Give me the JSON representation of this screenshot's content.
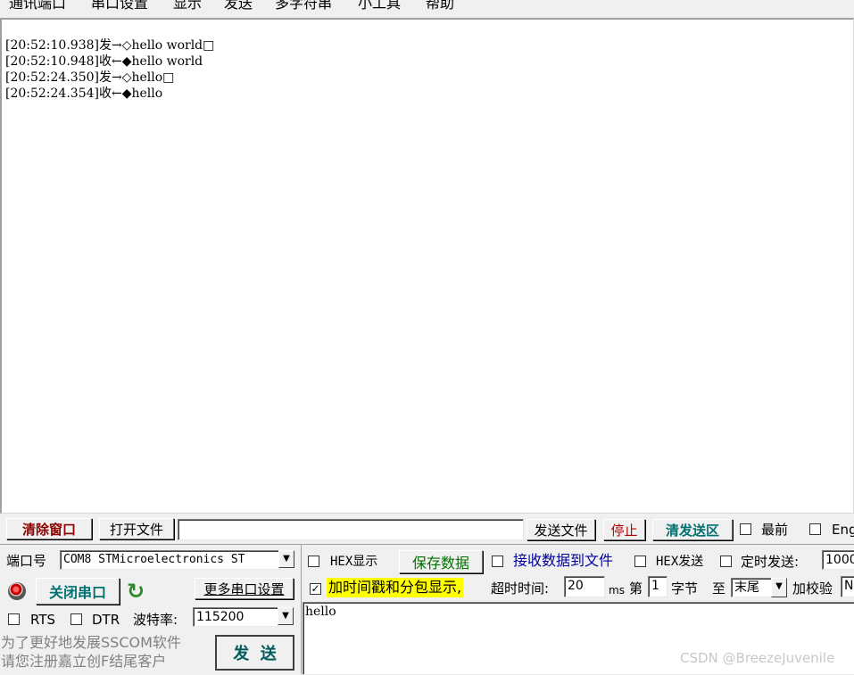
{
  "menu": [
    "通讯端口",
    "串口设置",
    "显示",
    "发送",
    "多字符串",
    "小工具",
    "帮助"
  ],
  "receive_lines": [
    "[20:52:10.938]发→◇hello world□",
    "[20:52:10.948]收←◆hello world",
    "[20:52:24.350]发→◇hello□",
    "[20:52:24.354]收←◆hello"
  ],
  "toolbar": {
    "clear_window": "清除窗口",
    "open_file": "打开文件",
    "file_path": "",
    "send_file": "发送文件",
    "stop": "停止",
    "clear_send": "清发送区",
    "topmost": "最前",
    "english": "English"
  },
  "port": {
    "label": "端口号",
    "value": "COM8 STMicroelectronics ST",
    "close_port": "关闭串口",
    "more_settings": "更多串口设置",
    "rts": "RTS",
    "dtr": "DTR",
    "baud_label": "波特率:",
    "baud_value": "115200"
  },
  "options": {
    "hex_display": "HEX显示",
    "save_data": "保存数据",
    "recv_to_file": "接收数据到文件",
    "hex_send": "HEX发送",
    "timed_send": "定时发送:",
    "timed_value": "1000",
    "timestamp": "加时间戳和分包显示,",
    "timeout_label": "超时时间:",
    "timeout_value": "20",
    "ms": "ms",
    "nth": "第",
    "byte_index": "1",
    "byte_label": "字节",
    "to": "至",
    "end_value": "末尾",
    "checksum_label": "加校验",
    "checksum_value": "N"
  },
  "send_text": "hello",
  "send_button": "发  送",
  "promo": {
    "line1": "为了更好地发展SSCOM软件",
    "line2": "请您注册嘉立创F结尾客户"
  },
  "watermark": "CSDN @BreezeJuvenile"
}
